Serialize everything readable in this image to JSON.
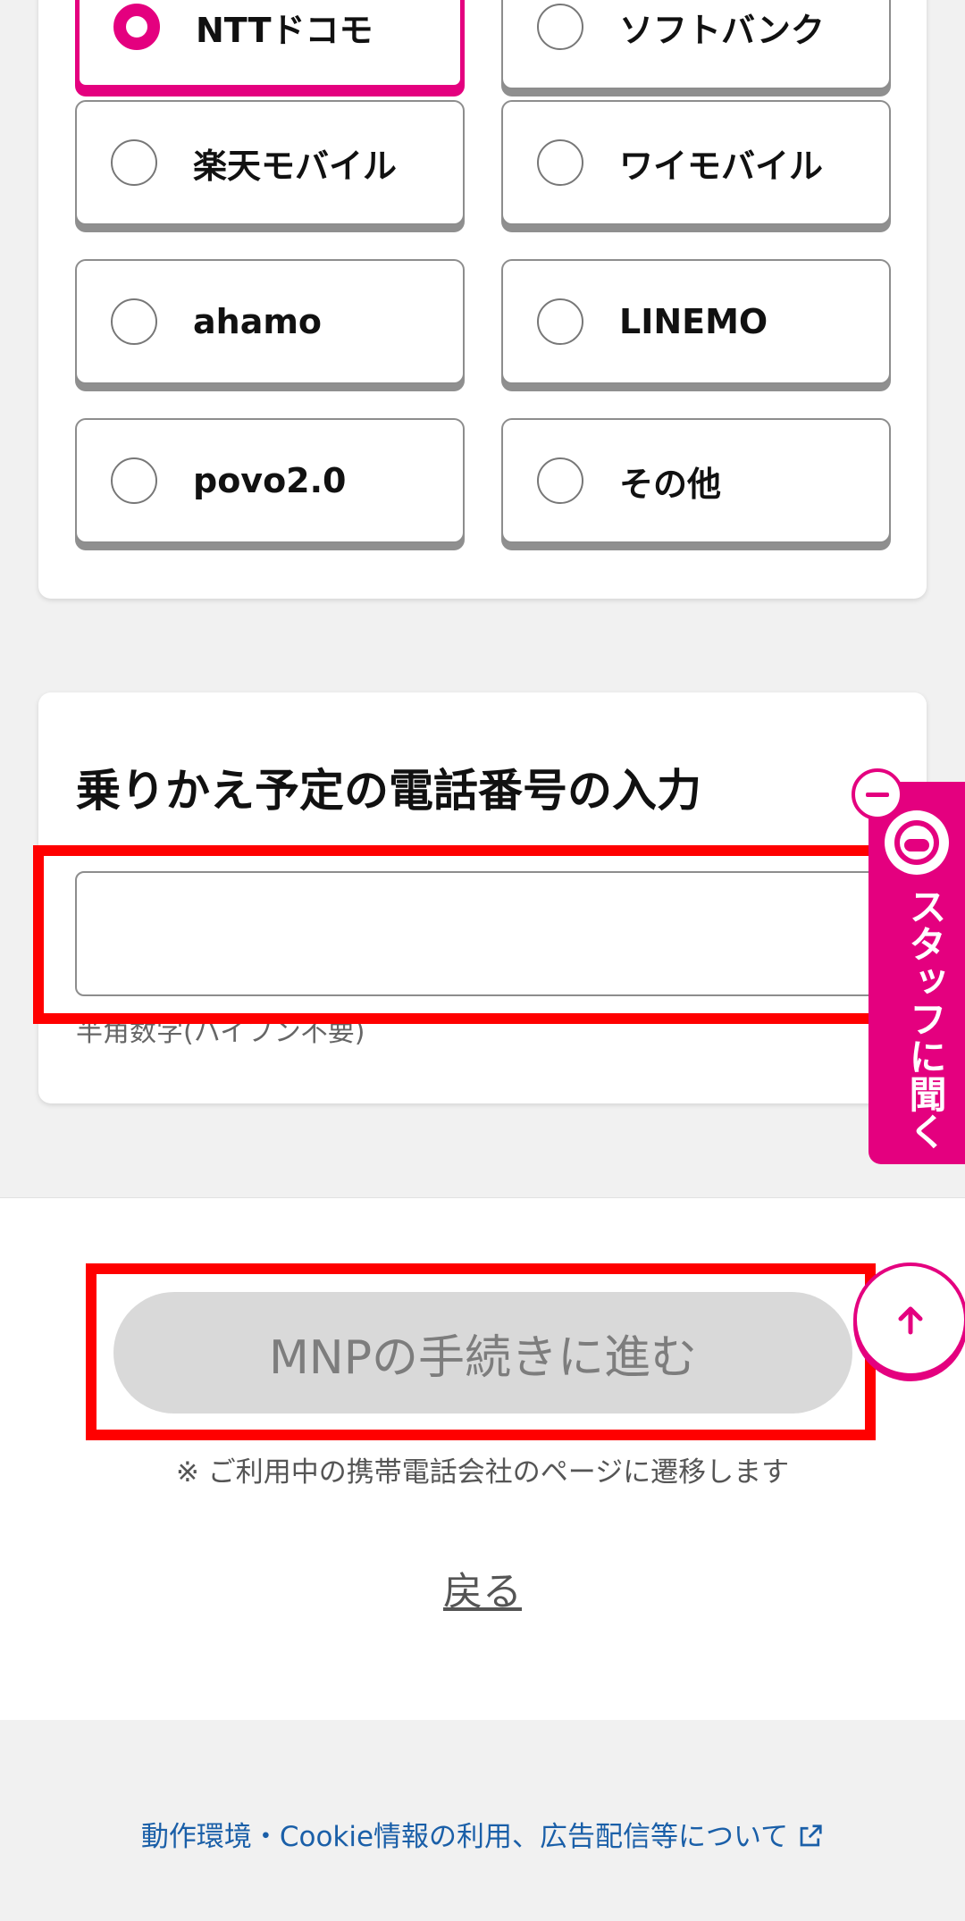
{
  "carrier_options": [
    {
      "label": "NTTドコモ",
      "selected": true
    },
    {
      "label": "ソフトバンク",
      "selected": false
    },
    {
      "label": "楽天モバイル",
      "selected": false
    },
    {
      "label": "ワイモバイル",
      "selected": false
    },
    {
      "label": "ahamo",
      "selected": false
    },
    {
      "label": "LINEMO",
      "selected": false
    },
    {
      "label": "povo2.0",
      "selected": false
    },
    {
      "label": "その他",
      "selected": false
    }
  ],
  "phone_section": {
    "title": "乗りかえ予定の電話番号の入力",
    "input_value": "",
    "hint": "半角数字(ハイフン不要)"
  },
  "actions": {
    "mnp_button_label": "MNPの手続きに進む",
    "note": "※ ご利用中の携帯電話会社のページに遷移します",
    "back_label": "戻る"
  },
  "staff_chat": {
    "label": "スタッフに聞く"
  },
  "footer": {
    "link_label": "動作環境・Cookie情報の利用、広告配信等について"
  },
  "colors": {
    "accent": "#e4007f",
    "highlight": "#ff0000",
    "link": "#1a5fa8",
    "disabled_button": "#d9d9d9"
  },
  "icons": [
    "external-link-icon",
    "arrow-up-icon",
    "minus-icon",
    "staff-avatar-icon"
  ]
}
